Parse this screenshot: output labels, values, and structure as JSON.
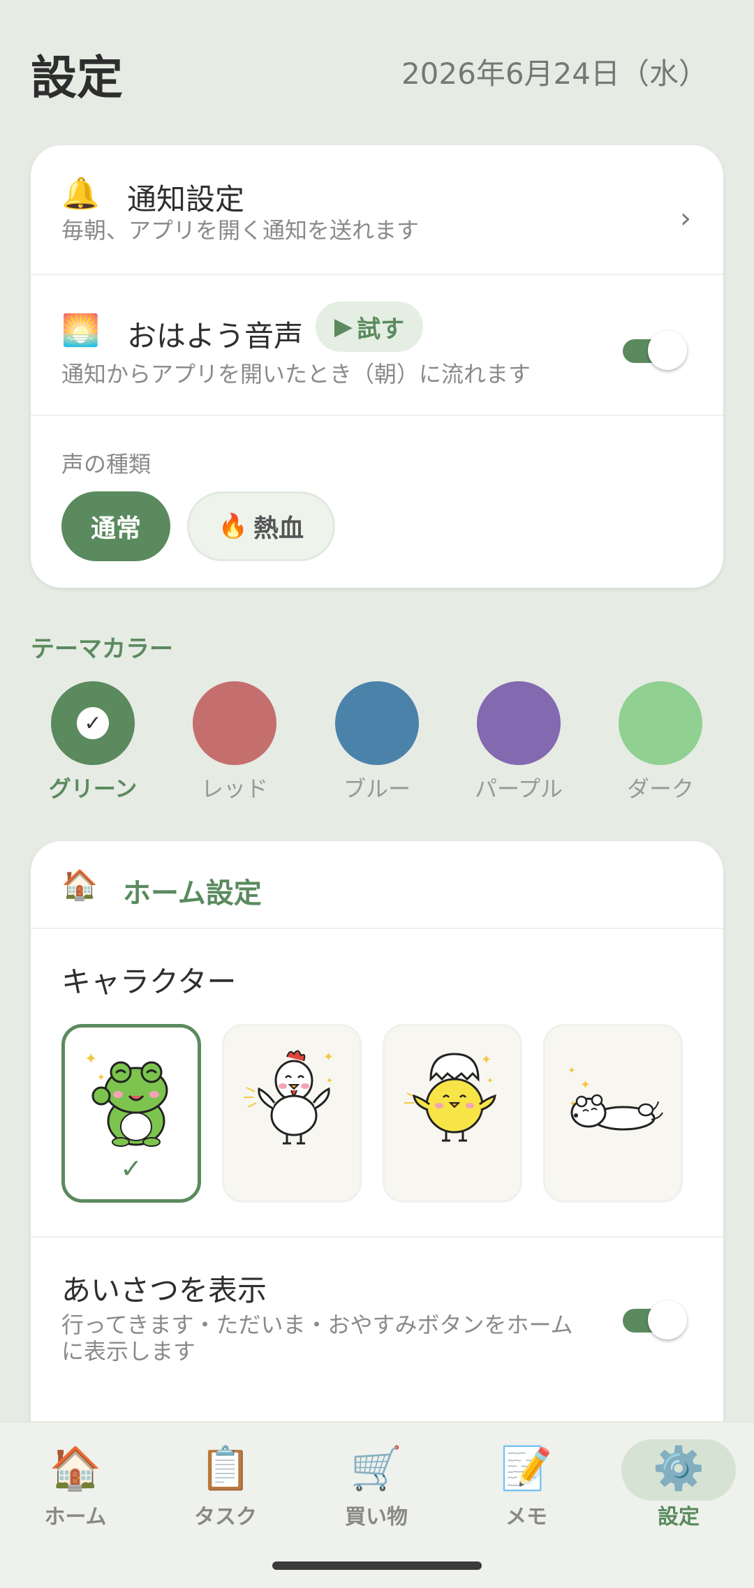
{
  "header": {
    "title": "設定",
    "date": "2026年6月24日（水）"
  },
  "notifications": {
    "icon": "bell-icon",
    "title": "通知設定",
    "subtitle": "毎朝、アプリを開く通知を送れます"
  },
  "morning_voice": {
    "icon": "sunrise-icon",
    "title": "おはよう音声",
    "try_label": "試す",
    "subtitle": "通知からアプリを開いたとき（朝）に流れます",
    "enabled": true
  },
  "voice_type": {
    "label": "声の種類",
    "options": [
      {
        "label": "通常",
        "selected": true
      },
      {
        "label": "熱血",
        "icon": "fire-icon",
        "selected": false
      }
    ]
  },
  "theme": {
    "heading": "テーマカラー",
    "options": [
      {
        "label": "グリーン",
        "color": "#5A8A5E",
        "selected": true
      },
      {
        "label": "レッド",
        "color": "#C46E6E",
        "selected": false
      },
      {
        "label": "ブルー",
        "color": "#4A82AA",
        "selected": false
      },
      {
        "label": "パープル",
        "color": "#8269B0",
        "selected": false
      },
      {
        "label": "ダーク",
        "color": "#90D090",
        "selected": false
      }
    ]
  },
  "home_settings": {
    "icon": "house-icon",
    "title": "ホーム設定",
    "character_heading": "キャラクター",
    "characters": [
      {
        "name": "frog",
        "selected": true
      },
      {
        "name": "chicken",
        "selected": false
      },
      {
        "name": "chick",
        "selected": false
      },
      {
        "name": "polar-bear",
        "selected": false
      }
    ],
    "greeting_title": "あいさつを表示",
    "greeting_subtitle": "行ってきます・ただいま・おやすみボタンをホームに表示します",
    "greeting_enabled": true
  },
  "bottom_nav": {
    "items": [
      {
        "label": "ホーム",
        "icon": "house-icon",
        "active": false
      },
      {
        "label": "タスク",
        "icon": "clipboard-icon",
        "active": false
      },
      {
        "label": "買い物",
        "icon": "cart-icon",
        "active": false
      },
      {
        "label": "メモ",
        "icon": "memo-icon",
        "active": false
      },
      {
        "label": "設定",
        "icon": "gear-icon",
        "active": true
      }
    ]
  },
  "colors": {
    "accent": "#5A8A5E",
    "background": "#E6EBE4"
  }
}
